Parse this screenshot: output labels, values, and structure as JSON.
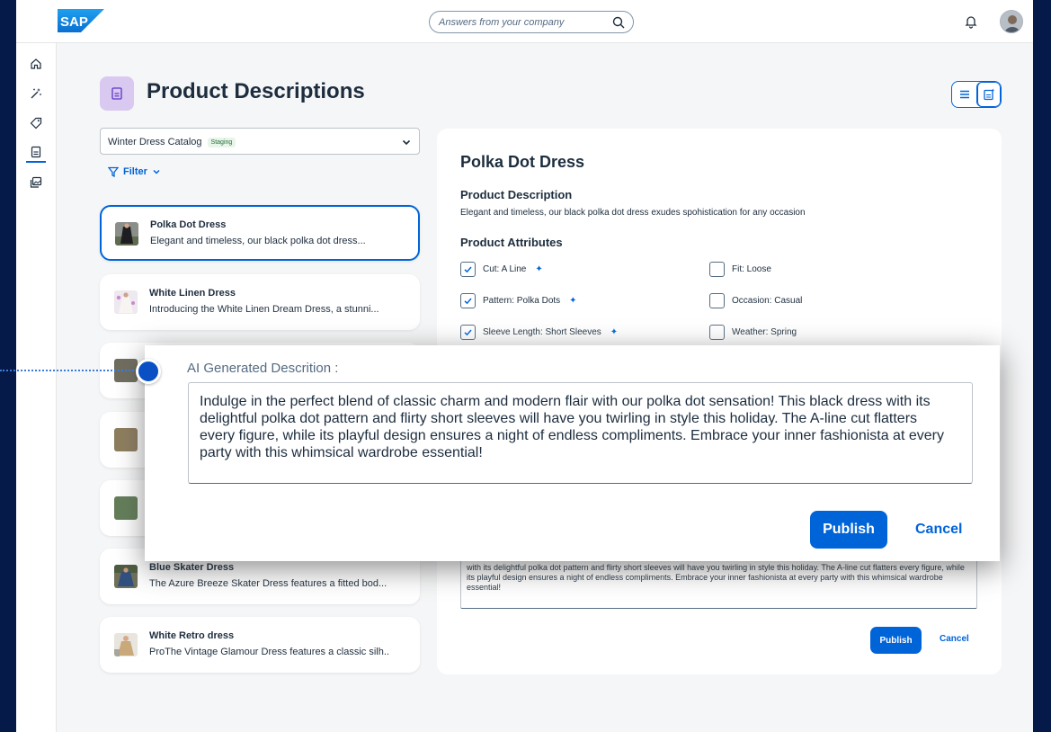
{
  "shellbar": {
    "logo_text": "SAP",
    "search_placeholder": "Answers from your company"
  },
  "sidebar": {
    "items": [
      {
        "icon": "home-icon"
      },
      {
        "icon": "magic-wand-icon"
      },
      {
        "icon": "tag-icon"
      },
      {
        "icon": "document-icon",
        "active": true
      },
      {
        "icon": "image-gallery-icon"
      }
    ]
  },
  "page": {
    "title": "Product Descriptions"
  },
  "catalog": {
    "name": "Winter Dress Catalog",
    "badge": "Staging"
  },
  "filter": {
    "label": "Filter"
  },
  "products": [
    {
      "name": "Polka Dot Dress",
      "desc": "Elegant and timeless, our black polka dot dress..."
    },
    {
      "name": "White Linen Dress",
      "desc": "Introducing the White Linen Dream Dress, a stunni..."
    },
    {
      "name": "Blue Skater Dress",
      "desc": "The Azure Breeze Skater Dress features a fitted bod..."
    },
    {
      "name": "White Retro dress",
      "desc": "ProThe Vintage Glamour Dress features a classic silh.."
    }
  ],
  "detail": {
    "title": "Polka Dot Dress",
    "desc_heading": "Product Description",
    "desc_text": "Elegant and timeless, our black polka dot dress exudes spohistication for any occasion",
    "attr_heading": "Product Attributes",
    "attributes": [
      {
        "label": "Cut: A Line",
        "checked": true,
        "ai": true
      },
      {
        "label": "Fit: Loose",
        "checked": false,
        "ai": false
      },
      {
        "label": "Pattern: Polka Dots",
        "checked": true,
        "ai": true
      },
      {
        "label": "Occasion: Casual",
        "checked": false,
        "ai": false
      },
      {
        "label": "Sleeve Length: Short Sleeves",
        "checked": true,
        "ai": true
      },
      {
        "label": "Weather: Spring",
        "checked": false,
        "ai": false
      }
    ],
    "generated_partial": "with its delightful polka dot pattern and flirty short sleeves will have you twirling in style this holiday. The A-line cut flatters every figure, while its playful design ensures a night of endless compliments. Embrace your inner fashionista at every party with this whimsical wardrobe essential!",
    "publish_label": "Publish",
    "cancel_label": "Cancel"
  },
  "popup": {
    "label": "AI Generated Descrition :",
    "text": "Indulge in the perfect blend of classic charm and modern flair with our polka dot sensation! This black dress with its delightful polka dot pattern and flirty short sleeves will have you twirling in style this holiday. The A-line cut flatters every figure, while its playful design ensures a night of endless compliments. Embrace your inner fashionista at every party with this whimsical wardrobe essential!",
    "publish_label": "Publish",
    "cancel_label": "Cancel"
  },
  "colors": {
    "accent": "#0064d9",
    "background_outer": "#061a4a",
    "page_bg": "#f5f6f7"
  }
}
